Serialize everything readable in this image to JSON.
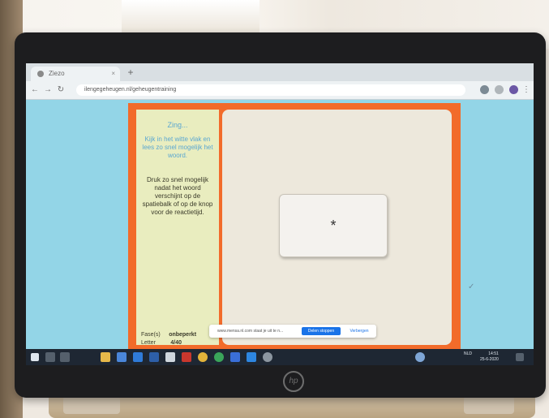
{
  "browser": {
    "tab_title": "Ziezo",
    "tab_close": "×",
    "new_tab": "+",
    "url": "ilengegeheugen.nl/geheugentraining"
  },
  "panel": {
    "title": "Zing...",
    "instructions_1": "Kijk in het witte vlak en lees zo snel mogelijk het woord.",
    "instructions_2": "Druk zo snel mogelijk nadat het woord verschijnt op de spatiebalk of op de knop voor de reactietijd.",
    "stat1_label": "Fase(s)",
    "stat1_value": "onbeperkt",
    "stat2_label": "Letter",
    "stat2_value": "4/40"
  },
  "game": {
    "card_symbol": "*"
  },
  "notification": {
    "text": "www.mensa.nl.com staat je uit te n...",
    "primary_button": "Delen stoppen",
    "secondary_button": "Verbergen"
  },
  "taskbar": {
    "time": "14:51",
    "date": "25-6-2020",
    "lang": "NLD"
  },
  "brand": {
    "logo": "hp"
  },
  "colors": {
    "page_background": "#93d5e7",
    "frame_orange": "#f26b2a",
    "panel_yellow": "#e9edbf",
    "accent_blue": "#1a73e8"
  }
}
